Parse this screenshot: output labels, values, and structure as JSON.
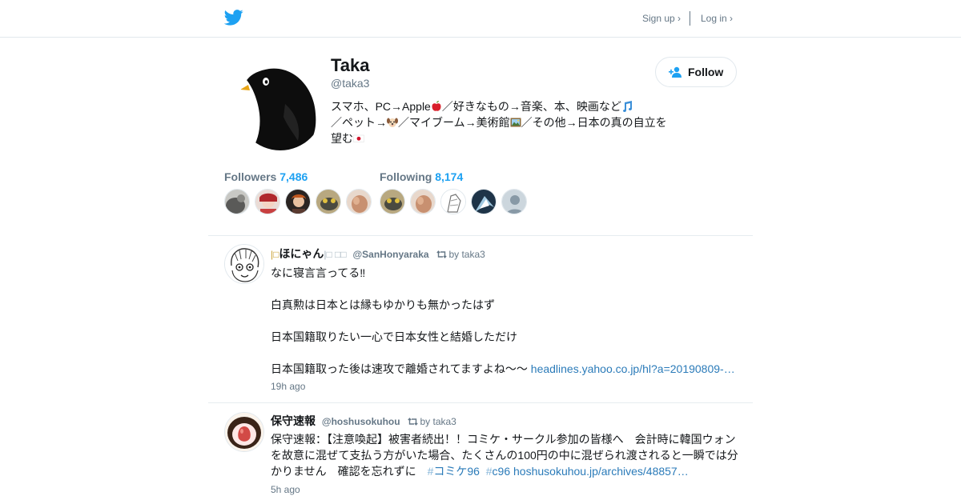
{
  "topbar": {
    "logo_icon": "twitter-bird-icon",
    "signup_label": "Sign up ›",
    "login_label": "Log in ›"
  },
  "profile": {
    "name": "Taka",
    "handle": "@taka3",
    "avatar_icon": "penguin-avatar",
    "bio": {
      "line1_text": "スマホ、PC→Apple",
      "line1_emoji": "apple-emoji",
      "line1_text2": "／好きなもの→音楽、本、映画など",
      "line1_emoji2": "music-notes-emoji",
      "line2_text": "／ペット→",
      "line2_emoji": "dog-face-emoji",
      "line2_text2": "／マイブーム→美術館",
      "line2_emoji2": "framed-picture-emoji",
      "line2_text3": "／その他→日本の真の自立を",
      "line3_text": "望む",
      "line3_emoji": "japan-flag-emoji"
    },
    "follow_label": "Follow",
    "followers_label": "Followers",
    "followers_count": "7,486",
    "following_label": "Following",
    "following_count": "8,174"
  },
  "tweets": [
    {
      "name_prefix": "|□",
      "name": "ほにゃん",
      "name_suffix": "|□ □□",
      "username": "@SanHonyaraka",
      "retweeted_by": "by taka3",
      "lines": [
        "なに寝言言ってる‼︎",
        "白真勲は日本とは縁もゆかりも無かったはず",
        "日本国籍取りたい一心で日本女性と結婚しただけ",
        "日本国籍取った後は速攻で離婚されてますよね〜〜"
      ],
      "link": "headlines.yahoo.co.jp/hl?a=20190809-…",
      "time": "19h ago"
    },
    {
      "name": "保守速報",
      "username": "@hoshusokuhou",
      "retweeted_by": "by taka3",
      "text": "保守速報：【注意喚起】被害者続出！！コミケ・サークル参加の皆様へ　会計時に韓国ウォンを故意に混ぜて支払う方がいた場合、たくさんの100円の中に混ぜられ渡されると一瞬では分かりません　確認を忘れずに　",
      "hashtag1": "コミケ96",
      "hashtag2": "c96",
      "link": "hoshusokuhou.jp/archives/48857…",
      "time": "5h ago"
    }
  ],
  "colors": {
    "brand_blue": "#1da1f2",
    "link_blue": "#2b7bb9",
    "muted_gray": "#657786",
    "text_dark": "#14171a",
    "border": "#e1e8ed"
  }
}
